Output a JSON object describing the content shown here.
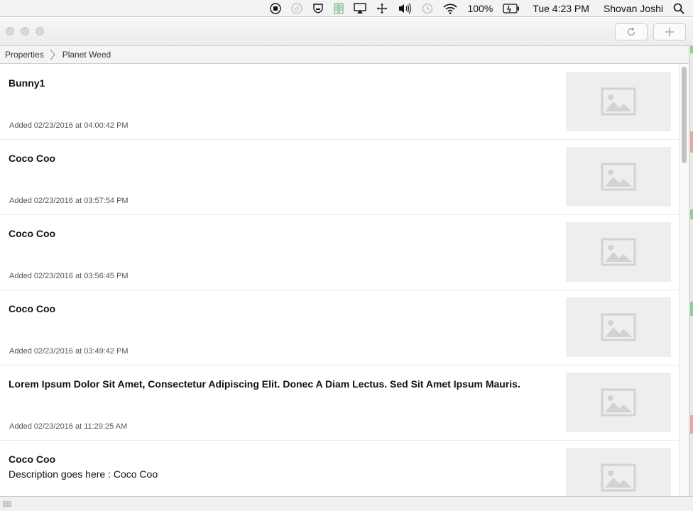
{
  "menubar": {
    "battery_percent": "100%",
    "clock": "Tue 4:23 PM",
    "user": "Shovan Joshi",
    "icons": [
      "record-icon",
      "d-badge-icon",
      "shield-icon",
      "stack-icon",
      "airplay-icon",
      "move-icon",
      "volume-icon",
      "time-machine-icon",
      "wifi-icon",
      "battery-icon",
      "search-icon"
    ]
  },
  "toolbar": {
    "refresh_icon": "refresh-icon",
    "add_icon": "plus-icon"
  },
  "breadcrumb": {
    "items": [
      "Properties",
      "Planet Weed"
    ]
  },
  "items": [
    {
      "title": "Bunny1",
      "description": "",
      "date": "Added 02/23/2016 at 04:00:42 PM",
      "thumb_icon": "image-placeholder-icon"
    },
    {
      "title": "Coco Coo",
      "description": "",
      "date": "Added 02/23/2016 at 03:57:54 PM",
      "thumb_icon": "image-placeholder-icon"
    },
    {
      "title": "Coco Coo",
      "description": "",
      "date": "Added 02/23/2016 at 03:56:45 PM",
      "thumb_icon": "image-placeholder-icon"
    },
    {
      "title": "Coco Coo",
      "description": "",
      "date": "Added 02/23/2016 at 03:49:42 PM",
      "thumb_icon": "image-placeholder-icon"
    },
    {
      "title": "Lorem Ipsum Dolor Sit Amet, Consectetur Adipiscing Elit. Donec A Diam Lectus. Sed Sit Amet Ipsum Mauris.",
      "description": "",
      "date": "Added 02/23/2016 at 11:29:25 AM",
      "thumb_icon": "image-placeholder-icon"
    },
    {
      "title": "Coco Coo",
      "description": "Description goes here : Coco Coo",
      "date": "",
      "thumb_icon": "image-placeholder-icon"
    }
  ],
  "colors": {
    "thumb_bg": "#eeeeee",
    "thumb_icon": "#d2d2d2",
    "accent_green": "#8fd08f",
    "accent_red": "#e6a6a6"
  }
}
